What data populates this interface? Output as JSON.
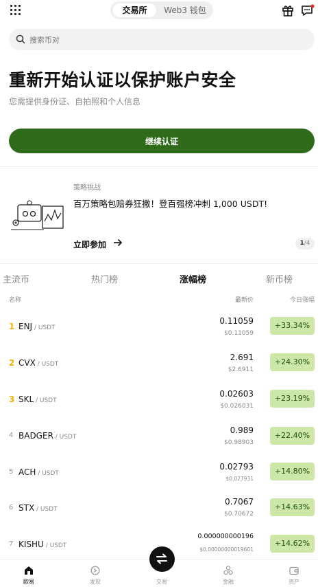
{
  "header": {
    "segments": [
      {
        "label": "交易所",
        "active": true
      },
      {
        "label": "Web3 钱包",
        "active": false
      }
    ],
    "icons": [
      "grid-menu-icon",
      "gift-icon",
      "message-icon"
    ]
  },
  "search": {
    "placeholder": "搜索币对"
  },
  "verify": {
    "title": "重新开始认证以保护账户安全",
    "subtitle": "您需提供身份证、自拍照和个人信息",
    "button_label": "继续认证"
  },
  "promo": {
    "tag": "策略挑战",
    "title": "百万策略包赔券狂撒！登百强榜冲刺 1,000 USDT!",
    "link_label": "立即参加",
    "pager_current": "1",
    "pager_total": "/4"
  },
  "market": {
    "tabs": [
      "主流币",
      "热门榜",
      "涨幅榜",
      "新币榜"
    ],
    "active_tab": "涨幅榜",
    "columns": {
      "name": "名称",
      "price": "最新价",
      "change": "今日涨幅"
    },
    "rows": [
      {
        "rank": "1",
        "base": "ENJ",
        "quote": " / USDT",
        "price": "0.11059",
        "fiat": "$0.11059",
        "change": "+33.34%"
      },
      {
        "rank": "2",
        "base": "CVX",
        "quote": " / USDT",
        "price": "2.691",
        "fiat": "$2.6911",
        "change": "+24.30%"
      },
      {
        "rank": "3",
        "base": "SKL",
        "quote": " / USDT",
        "price": "0.02603",
        "fiat": "$0.026031",
        "change": "+23.19%"
      },
      {
        "rank": "4",
        "base": "BADGER",
        "quote": " / USDT",
        "price": "0.989",
        "fiat": "$0.98903",
        "change": "+22.40%"
      },
      {
        "rank": "5",
        "base": "ACH",
        "quote": " / USDT",
        "price": "0.02793",
        "fiat": "$0.027931",
        "change": "+14.80%"
      },
      {
        "rank": "6",
        "base": "STX",
        "quote": " / USDT",
        "price": "0.7067",
        "fiat": "$0.70672",
        "change": "+14.63%"
      },
      {
        "rank": "7",
        "base": "KISHU",
        "quote": " / USDT",
        "price": "0.000000000196",
        "fiat": "$0.00000000019601",
        "change": "+14.62%"
      }
    ],
    "colors": {
      "change_bg": "#cde7a8",
      "change_text": "#1f4f0d",
      "top_rank": "#f0b400"
    }
  },
  "nav": {
    "items": [
      {
        "label": "欧易",
        "icon": "home-icon",
        "active": true
      },
      {
        "label": "发现",
        "icon": "discover-icon",
        "active": false
      },
      {
        "label": "交易",
        "icon": "swap-icon",
        "active": false
      },
      {
        "label": "金融",
        "icon": "finance-icon",
        "active": false
      },
      {
        "label": "资产",
        "icon": "wallet-icon",
        "active": false
      }
    ]
  },
  "colors": {
    "brand": "#2f6b1b"
  }
}
